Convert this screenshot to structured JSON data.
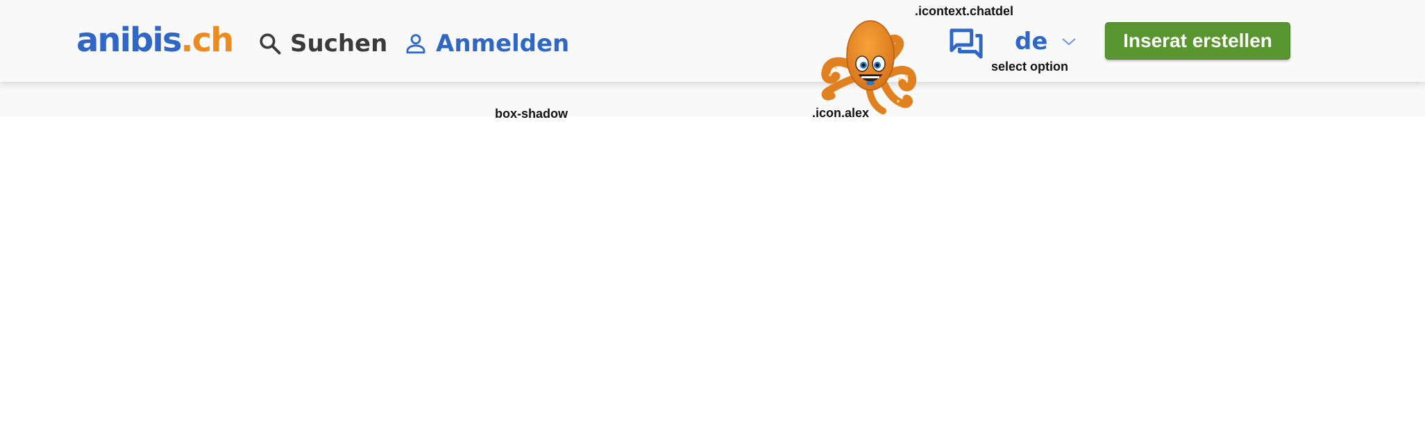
{
  "header": {
    "logo": {
      "part_a": "anibis",
      "part_b": ".ch"
    },
    "search": {
      "label": "Suchen",
      "icon": "search-icon"
    },
    "login": {
      "label": "Anmelden",
      "icon": "user-icon"
    },
    "mascot": {
      "icon": "octopus-mascot-icon"
    },
    "chat": {
      "icon": "chat-bubbles-icon"
    },
    "language": {
      "selected": "de",
      "icon": "chevron-down-icon"
    },
    "cta_label": "Inserat erstellen"
  },
  "annotations": {
    "chatdel": ".icontext.chatdel",
    "select": "select option",
    "shadow": "box-shadow",
    "alex": ".icon.alex"
  },
  "colors": {
    "brand_blue": "#2f67c7",
    "brand_orange": "#ef8a1d",
    "cta_green": "#5a9630",
    "header_bg": "#f9f9f9",
    "text_dark": "#3a3a3a"
  }
}
